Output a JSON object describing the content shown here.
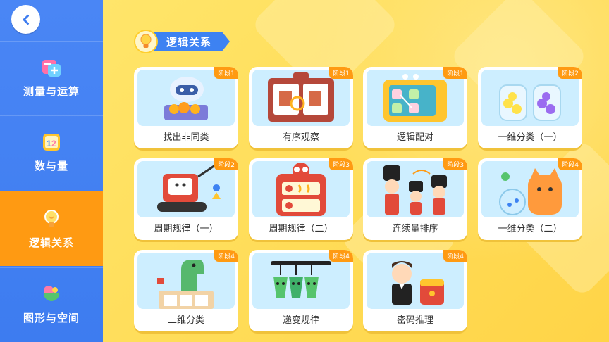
{
  "sidebar": {
    "items": [
      {
        "label": "测量与运算",
        "icon": "ruler-plus-icon"
      },
      {
        "label": "数与量",
        "icon": "number-blocks-icon"
      },
      {
        "label": "逻辑关系",
        "icon": "lightbulb-icon"
      },
      {
        "label": "图形与空间",
        "icon": "shapes-icon"
      }
    ],
    "active_index": 2
  },
  "section": {
    "title": "逻辑关系"
  },
  "cards": [
    {
      "name": "找出非同类",
      "stage": "阶段1"
    },
    {
      "name": "有序观察",
      "stage": "阶段1"
    },
    {
      "name": "逻辑配对",
      "stage": "阶段1"
    },
    {
      "name": "一维分类（一）",
      "stage": "阶段2"
    },
    {
      "name": "周期规律（一）",
      "stage": "阶段2"
    },
    {
      "name": "周期规律（二）",
      "stage": "阶段3"
    },
    {
      "name": "连续量排序",
      "stage": "阶段3"
    },
    {
      "name": "一维分类（二）",
      "stage": "阶段4"
    },
    {
      "name": "二维分类",
      "stage": "阶段4"
    },
    {
      "name": "递变规律",
      "stage": "阶段4"
    },
    {
      "name": "密码推理",
      "stage": "阶段4"
    }
  ],
  "colors": {
    "sidebar": "#3d7cf0",
    "active": "#ff9a12",
    "background": "#ffd84d",
    "stage_badge": "#ff9a12"
  }
}
